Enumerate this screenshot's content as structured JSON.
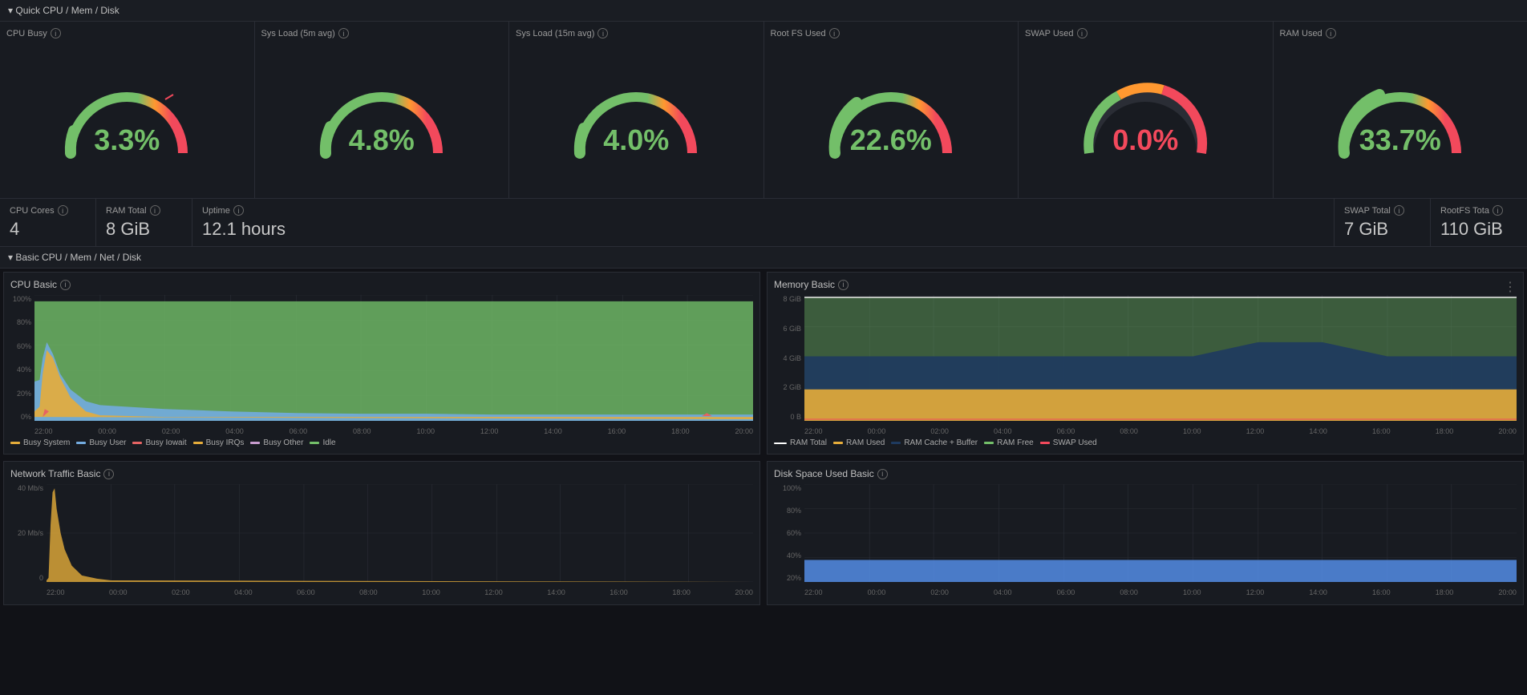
{
  "quick_section": {
    "title": "▾ Quick CPU / Mem / Disk",
    "gauges": [
      {
        "id": "cpu-busy",
        "label": "CPU Busy",
        "value": "3.3%",
        "color": "green",
        "arc_pct": 3.3
      },
      {
        "id": "sys-load-5m",
        "label": "Sys Load (5m avg)",
        "value": "4.8%",
        "color": "green",
        "arc_pct": 4.8
      },
      {
        "id": "sys-load-15m",
        "label": "Sys Load (15m avg)",
        "value": "4.0%",
        "color": "green",
        "arc_pct": 4.0
      },
      {
        "id": "root-fs",
        "label": "Root FS Used",
        "value": "22.6%",
        "color": "green",
        "arc_pct": 22.6
      },
      {
        "id": "swap-used",
        "label": "SWAP Used",
        "value": "0.0%",
        "color": "red",
        "arc_pct": 0
      },
      {
        "id": "ram-used",
        "label": "RAM Used",
        "value": "33.7%",
        "color": "green",
        "arc_pct": 33.7
      }
    ],
    "stats": [
      {
        "id": "cpu-cores",
        "label": "CPU Cores",
        "value": "4"
      },
      {
        "id": "ram-total",
        "label": "RAM Total",
        "value": "8 GiB"
      },
      {
        "id": "uptime",
        "label": "Uptime",
        "value": "12.1 hours"
      },
      {
        "id": "swap-total",
        "label": "SWAP Total",
        "value": "7 GiB"
      },
      {
        "id": "rootfs-total",
        "label": "RootFS Tota",
        "value": "110 GiB"
      }
    ]
  },
  "basic_section": {
    "title": "▾ Basic CPU / Mem / Net / Disk",
    "cpu_chart": {
      "title": "CPU Basic",
      "y_labels": [
        "100%",
        "80%",
        "60%",
        "40%",
        "20%",
        "0%"
      ],
      "x_labels": [
        "22:00",
        "00:00",
        "02:00",
        "04:00",
        "06:00",
        "08:00",
        "10:00",
        "12:00",
        "14:00",
        "16:00",
        "18:00",
        "20:00"
      ],
      "legend": [
        {
          "label": "Busy System",
          "color": "#f2c94c"
        },
        {
          "label": "Busy User",
          "color": "#73abdf"
        },
        {
          "label": "Busy Iowait",
          "color": "#e56363"
        },
        {
          "label": "Busy IRQs",
          "color": "#e5ac3a"
        },
        {
          "label": "Busy Other",
          "color": "#c79bce"
        },
        {
          "label": "Idle",
          "color": "#73bf69"
        }
      ]
    },
    "memory_chart": {
      "title": "Memory Basic",
      "y_labels": [
        "8 GiB",
        "6 GiB",
        "4 GiB",
        "2 GiB",
        "0 B"
      ],
      "x_labels": [
        "22:00",
        "00:00",
        "02:00",
        "04:00",
        "06:00",
        "08:00",
        "10:00",
        "12:00",
        "14:00",
        "16:00",
        "18:00",
        "20:00"
      ],
      "legend": [
        {
          "label": "RAM Total",
          "color": "#ffffff"
        },
        {
          "label": "RAM Used",
          "color": "#e5ac3a"
        },
        {
          "label": "RAM Cache + Buffer",
          "color": "#1e3a5f"
        },
        {
          "label": "RAM Free",
          "color": "#73bf69"
        },
        {
          "label": "SWAP Used",
          "color": "#e56363"
        }
      ]
    },
    "network_chart": {
      "title": "Network Traffic Basic",
      "y_labels": [
        "40 Mb/s",
        "20 Mb/s",
        "0"
      ],
      "x_labels": [
        "22:00",
        "00:00",
        "02:00",
        "04:00",
        "06:00",
        "08:00",
        "10:00",
        "12:00",
        "14:00",
        "16:00",
        "18:00",
        "20:00"
      ]
    },
    "disk_chart": {
      "title": "Disk Space Used Basic",
      "y_labels": [
        "100%",
        "80%",
        "60%",
        "40%",
        "20%"
      ],
      "x_labels": [
        "22:00",
        "00:00",
        "02:00",
        "04:00",
        "06:00",
        "08:00",
        "10:00",
        "12:00",
        "14:00",
        "16:00",
        "18:00",
        "20:00"
      ]
    }
  },
  "icons": {
    "info": "i",
    "dots": "⋮",
    "chevron_down": "▾"
  },
  "colors": {
    "green": "#73bf69",
    "red": "#f2495c",
    "orange": "#ff9830",
    "yellow": "#e5ac3a",
    "blue": "#1e3a5f",
    "light_blue": "#73abdf",
    "purple": "#c79bce",
    "bg_panel": "#181b21",
    "bg_body": "#111217",
    "border": "#2a2d35",
    "text_muted": "#9a9a9a"
  }
}
